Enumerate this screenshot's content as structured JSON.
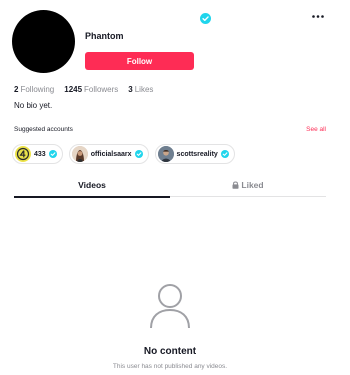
{
  "profile": {
    "username": "Phantom",
    "follow_label": "Follow",
    "bio": "No bio yet."
  },
  "stats": {
    "following_count": "2",
    "following_label": "Following",
    "followers_count": "1245",
    "followers_label": "Followers",
    "likes_count": "3",
    "likes_label": "Likes"
  },
  "suggested": {
    "title": "Suggested accounts",
    "see_all": "See all",
    "accounts": [
      {
        "name": "433"
      },
      {
        "name": "officialsaarx"
      },
      {
        "name": "scottsreality"
      }
    ]
  },
  "tabs": {
    "videos": "Videos",
    "liked": "Liked"
  },
  "empty": {
    "title": "No content",
    "subtitle": "This user has not published any videos."
  },
  "colors": {
    "accent": "#fe2c55",
    "verified": "#20d5ec",
    "text": "#161823",
    "muted": "#8a8b91"
  },
  "icons": {
    "verified": "verified-badge-icon",
    "more": "more-dots-icon",
    "lock": "lock-icon",
    "empty": "user-outline-icon"
  }
}
